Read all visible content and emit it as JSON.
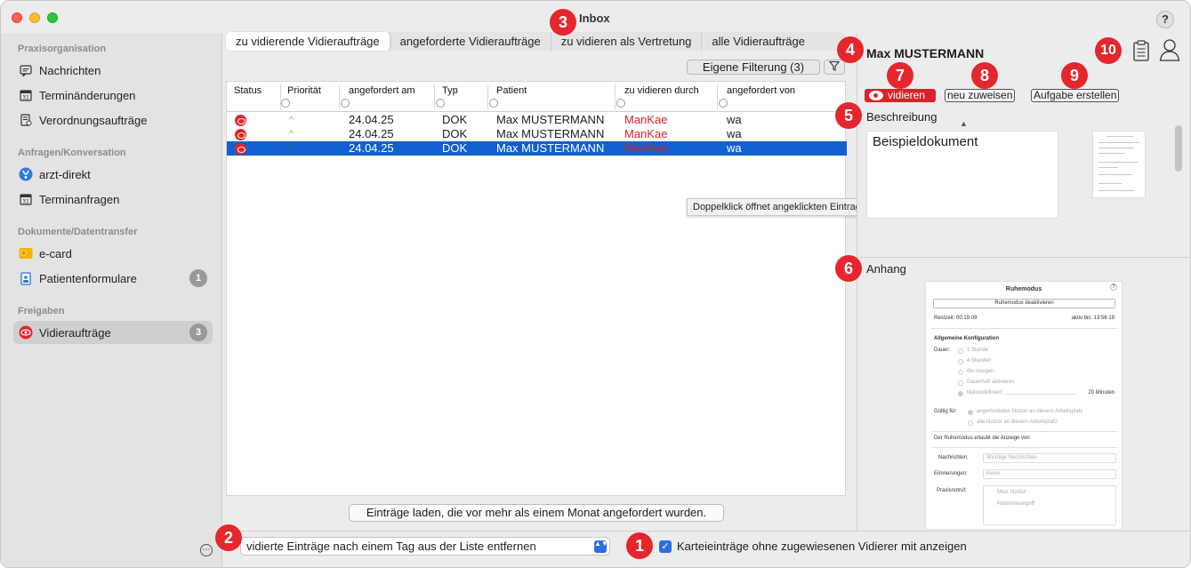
{
  "window": {
    "title": "Inbox",
    "help": "?"
  },
  "sidebar": {
    "sections": [
      {
        "label": "Praxisorganisation"
      },
      {
        "label": "Anfragen/Konversation"
      },
      {
        "label": "Dokumente/Datentransfer"
      },
      {
        "label": "Freigaben"
      }
    ],
    "items": [
      {
        "label": "Nachrichten",
        "icon": "message-icon"
      },
      {
        "label": "Terminänderungen",
        "icon": "calendar-icon"
      },
      {
        "label": "Verordnungsaufträge",
        "icon": "prescription-icon"
      },
      {
        "label": "arzt-direkt",
        "icon": "arzt-direkt-icon"
      },
      {
        "label": "Terminanfragen",
        "icon": "calendar-icon"
      },
      {
        "label": "e-card",
        "icon": "ecard-icon"
      },
      {
        "label": "Patientenformulare",
        "icon": "form-icon",
        "badge": "1"
      },
      {
        "label": "Vidieraufträge",
        "icon": "eye-icon",
        "badge": "3"
      }
    ],
    "more": "⋯"
  },
  "tabs": [
    {
      "label": "zu vidierende Vidieraufträge"
    },
    {
      "label": "angeforderte Vidieraufträge"
    },
    {
      "label": "zu vidieren als Vertretung"
    },
    {
      "label": "alle Vidieraufträge"
    }
  ],
  "toolbar": {
    "filter_label": "Eigene Filterung (3)",
    "funnel": "⧩"
  },
  "table": {
    "headers": [
      "Status",
      "Priorität",
      "angefordert am",
      "Typ",
      "Patient",
      "zu vidieren durch",
      "angefordert von"
    ],
    "rows": [
      {
        "date": "24.04.25",
        "type": "DOK",
        "patient": "Max MUSTERMANN",
        "by": "ManKae",
        "from": "wa"
      },
      {
        "date": "24.04.25",
        "type": "DOK",
        "patient": "Max MUSTERMANN",
        "by": "ManKae",
        "from": "wa"
      },
      {
        "date": "24.04.25",
        "type": "DOK",
        "patient": "Max MUSTERMANN",
        "by": "ManKae",
        "from": "wa"
      }
    ],
    "prio_glyph": "^"
  },
  "tooltip": "Doppelklick öffnet angeklickten Eintrag in Kartei",
  "load_button": "Einträge laden, die vor mehr als einem Monat angefordert wurden.",
  "bottom": {
    "select_value": "vidierte Einträge nach einem Tag aus der Liste entfernen",
    "checkbox_label": "Karteieinträge ohne zugewiesenen Vidierer mit anzeigen",
    "check_glyph": "✓",
    "select_arrow": "▲▼"
  },
  "detail": {
    "patient_name": "Max MUSTERMANN",
    "btn_vidieren": "vidieren",
    "btn_reassign": "neu zuweisen",
    "btn_task": "Aufgabe erstellen",
    "desc_title": "Beschreibung",
    "desc_text": "Beispieldokument",
    "attach_title": "Anhang",
    "collapse": "▲"
  },
  "attachment": {
    "title": "Ruhemodus",
    "help": "?",
    "button": "Ruhemodus deaktivieren",
    "rest": "Restzeit: 00:19:09",
    "active": "aktiv bis: 13:56:19",
    "general": "Allgemeine Konfiguration",
    "duration": "Dauer:",
    "opt1": "1 Stunde",
    "opt2": "4 Stunden",
    "opt3": "Bis morgen",
    "opt4": "Dauerhaft aktivieren",
    "opt5": "Nutzerdefiniert:",
    "minutes": "20 Minuten",
    "valid": "Gültig für:",
    "valid1": "angemeldeten Nutzer an diesem Arbeitsplatz",
    "valid2": "alle Nutzer an diesem Arbeitsplatz",
    "allows": "Der Ruhemodus erlaubt die Anzeige von",
    "messages": "Nachrichten:",
    "messages_val": "Wichtige Nachrichten",
    "reminders": "Erinnerungen:",
    "reminders_val": "Keine",
    "emergency": "Praxisnotruf:",
    "em1": "Mod. Notfall",
    "em2": "Patientenangriff"
  },
  "markers": [
    "1",
    "2",
    "3",
    "4",
    "5",
    "6",
    "7",
    "8",
    "9",
    "10"
  ],
  "colors": {
    "accent": "#e5262d",
    "selection": "#1060d0",
    "checkbox": "#2b6fe0"
  }
}
